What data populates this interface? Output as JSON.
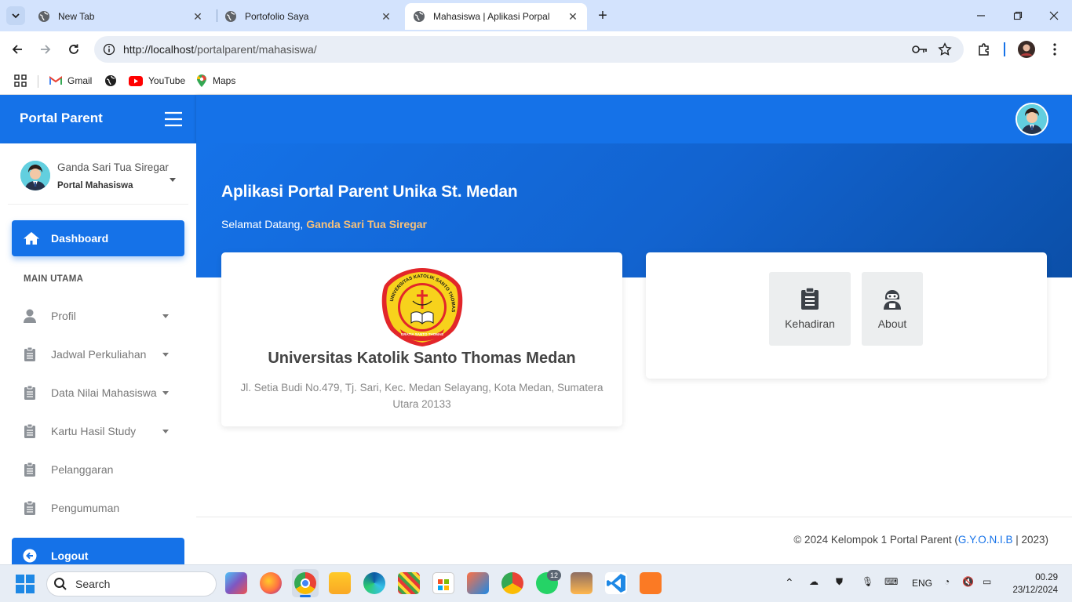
{
  "browser": {
    "tabs": [
      {
        "title": "New Tab",
        "active": false
      },
      {
        "title": "Portofolio Saya",
        "active": false
      },
      {
        "title": "Mahasiswa | Aplikasi Porpal",
        "active": true
      }
    ],
    "new_tab": "+",
    "url_host": "http://localhost",
    "url_path": "/portalparent/mahasiswa/",
    "bookmarks": [
      {
        "label": "Gmail",
        "icon": "gmail-icon"
      },
      {
        "label": "",
        "icon": "globe-icon"
      },
      {
        "label": "YouTube",
        "icon": "youtube-icon"
      },
      {
        "label": "Maps",
        "icon": "maps-icon"
      }
    ]
  },
  "app": {
    "brand": "Portal Parent",
    "user": {
      "name": "Ganda Sari Tua Siregar",
      "role": "Portal Mahasiswa"
    },
    "nav": {
      "dashboard": "Dashboard",
      "section": "MAIN UTAMA",
      "items": [
        {
          "label": "Profil",
          "icon": "user-icon",
          "caret": true
        },
        {
          "label": "Jadwal Perkuliahan",
          "icon": "clipboard-icon",
          "caret": true
        },
        {
          "label": "Data Nilai Mahasiswa",
          "icon": "clipboard-icon",
          "caret": true
        },
        {
          "label": "Kartu Hasil Study",
          "icon": "clipboard-icon",
          "caret": true
        },
        {
          "label": "Pelanggaran",
          "icon": "clipboard-icon",
          "caret": false
        },
        {
          "label": "Pengumuman",
          "icon": "clipboard-icon",
          "caret": false
        }
      ],
      "logout": "Logout"
    },
    "hero": {
      "title": "Aplikasi Portal Parent Unika St. Medan",
      "welcome_prefix": "Selamat Datang,",
      "welcome_name": "Ganda Sari Tua Siregar"
    },
    "university": {
      "name": "Universitas Katolik Santo Thomas Medan",
      "address": "Jl. Setia Budi No.479, Tj. Sari, Kec. Medan Selayang, Kota Medan, Sumatera Utara 20133",
      "logo_ring_text": "UNIVERSITAS KATOLIK SANTO THOMAS",
      "logo_motto": "GRATIA SANTO THOMAE"
    },
    "quick": [
      {
        "label": "Kehadiran",
        "icon": "clipboard-icon"
      },
      {
        "label": "About",
        "icon": "robot-icon"
      }
    ],
    "footer": {
      "prefix": "© 2024 Kelompok 1 Portal Parent (",
      "link": "G.Y.O.N.I.B",
      "suffix": " | 2023)"
    },
    "colors": {
      "primary": "#1572e8",
      "accent_name": "#f6c07a"
    }
  },
  "taskbar": {
    "search": "Search",
    "whatsapp_badge": "12",
    "lang": "ENG",
    "time": "00.29",
    "date": "23/12/2024"
  }
}
